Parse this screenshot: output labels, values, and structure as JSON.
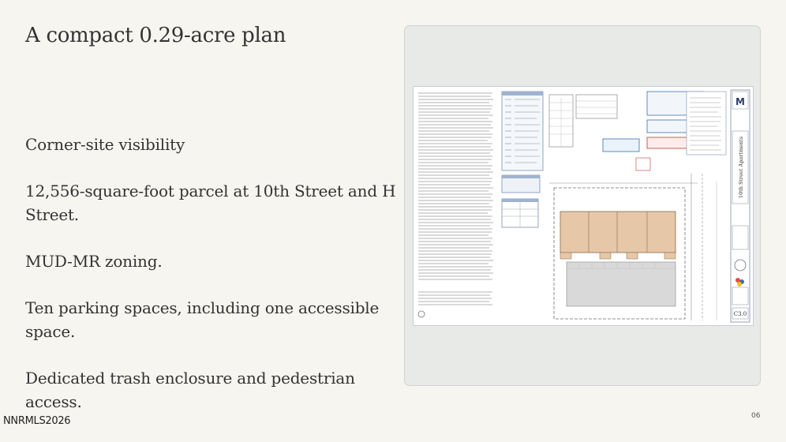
{
  "slide": {
    "title": "A compact 0.29-acre plan",
    "bullets": [
      "Corner-site visibility",
      "12,556-square-foot parcel at 10th Street and H Street.",
      "MUD-MR zoning.",
      "Ten parking spaces, including one accessible space.",
      "Dedicated trash enclosure and pedestrian access."
    ],
    "footer_left": "NNRMLS2026",
    "page_number": "06"
  },
  "plan": {
    "project_name": "10th Street Apartments",
    "sheet_number": "C3.0",
    "logo_letter": "M",
    "colors": {
      "building": "#e6c7a8",
      "parking": "#d9d9d9",
      "callout_blue": "#3a6fb5",
      "callout_red": "#c0392b"
    }
  }
}
